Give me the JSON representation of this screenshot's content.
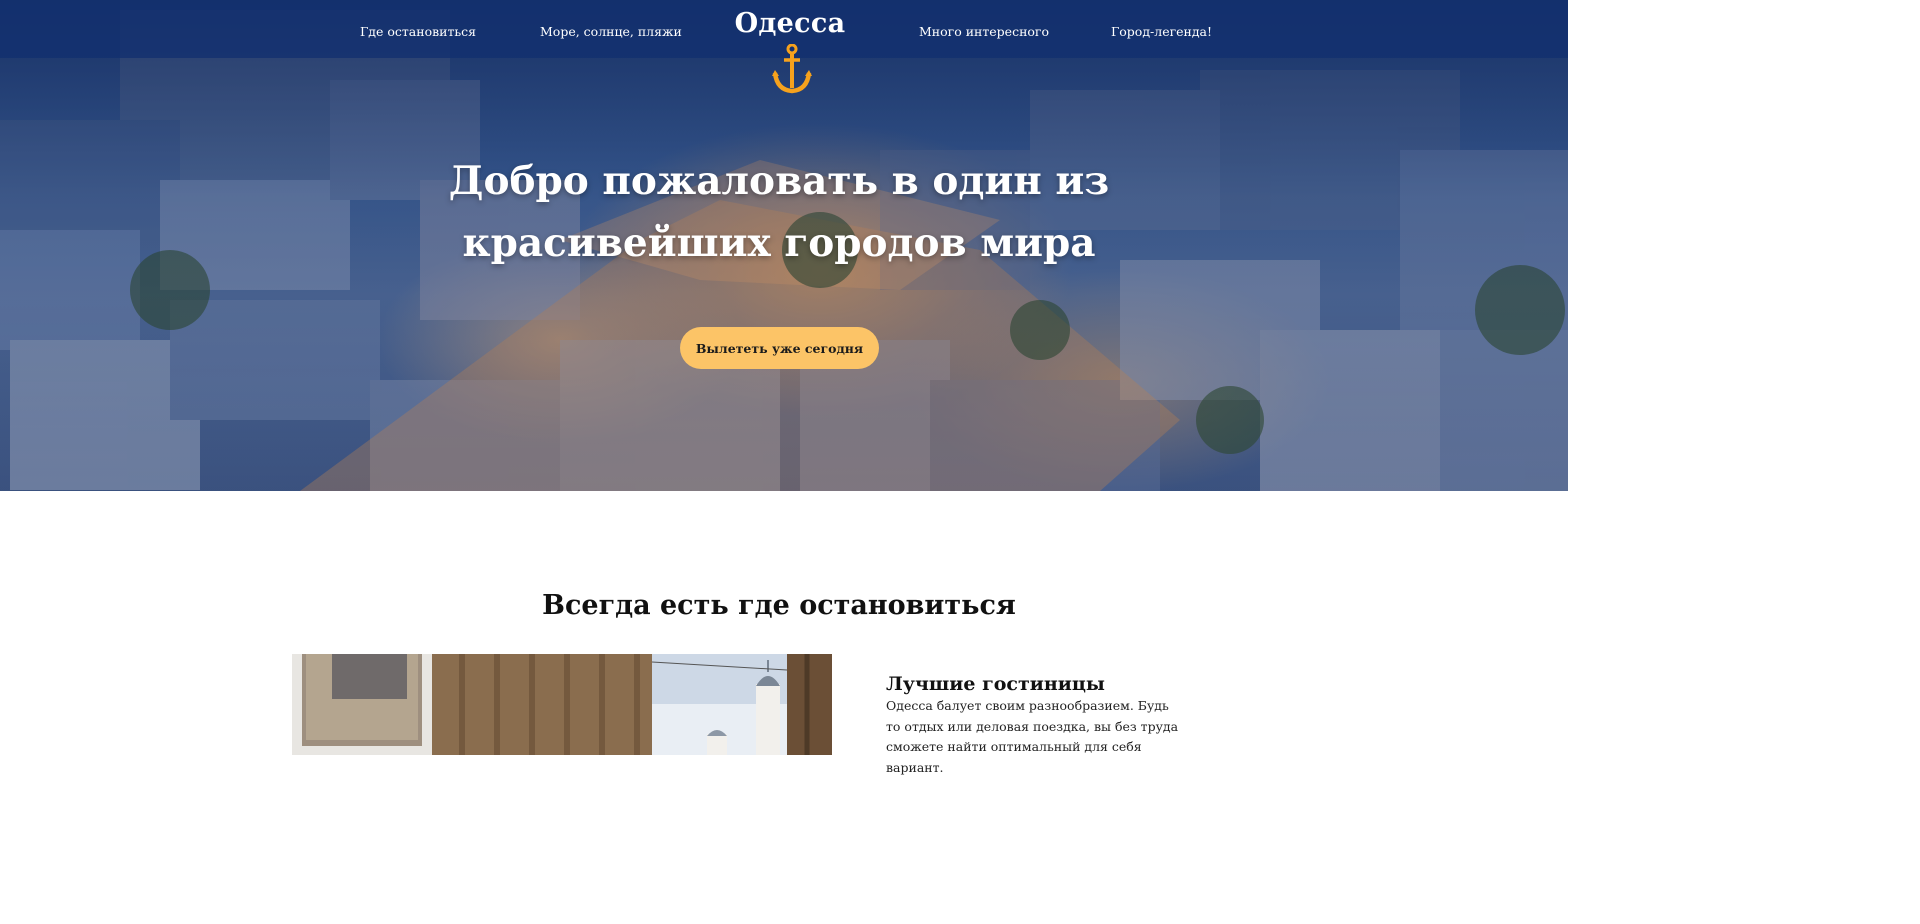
{
  "header": {
    "brand": "Одесса",
    "nav": [
      {
        "label": "Где остановиться"
      },
      {
        "label": "Море, солнце, пляжи"
      },
      {
        "label": "Много интересного"
      },
      {
        "label": "Город-легенда!"
      }
    ]
  },
  "hero": {
    "title": "Добро пожаловать в один из красивейших городов мира",
    "cta_label": "Вылететь уже сегодня"
  },
  "stay_section": {
    "title": "Всегда есть где остановиться",
    "card": {
      "title": "Лучшие гостиницы",
      "text": "Одесса балует своим разнообразием. Будь то отдых или деловая поездка, вы без труда сможете найти оптимальный для себя вариант."
    }
  },
  "colors": {
    "header_bar": "#123070",
    "accent": "#fcc467",
    "anchor": "#f6a21d",
    "text": "#111111"
  },
  "icons": {
    "logo": "anchor-icon"
  }
}
